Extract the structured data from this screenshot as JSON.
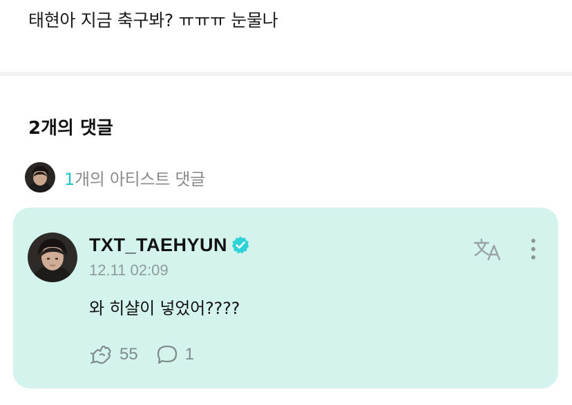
{
  "post": {
    "text": "태현아 지금 축구봐? ㅠㅠㅠ 눈물나"
  },
  "comments_header": {
    "title": "2개의 댓글"
  },
  "artist_comments": {
    "count": "1",
    "label": "개의 아티스트 댓글"
  },
  "comment": {
    "username": "TXT_TAEHYUN",
    "timestamp": "12.11 02:09",
    "body": "와 히샬이 넣었어????",
    "likes": "55",
    "replies": "1",
    "verified_icon": "verified-badge-icon",
    "translate_icon": "translate-icon",
    "more_icon": "more-vertical-icon",
    "like_icon": "cheer-icon",
    "reply_icon": "comment-bubble-icon"
  },
  "colors": {
    "card_background": "#d3f3ec",
    "accent": "#19c6c6",
    "verified": "#2fd2d6",
    "muted_text": "#8e9a98"
  }
}
